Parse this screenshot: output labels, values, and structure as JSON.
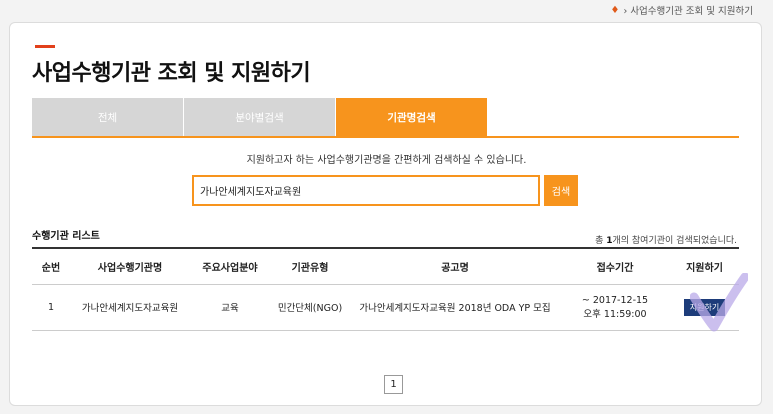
{
  "breadcrumb": {
    "text": "› 사업수행기관 조회 및 지원하기"
  },
  "page": {
    "title": "사업수행기관 조회 및 지원하기"
  },
  "tabs": [
    {
      "label": "전체"
    },
    {
      "label": "분야별검색"
    },
    {
      "label": "기관명검색"
    }
  ],
  "search": {
    "description": "지원하고자 하는 사업수행기관명을 간편하게 검색하실 수 있습니다.",
    "value": "가나안세계지도자교육원",
    "button_label": "검색"
  },
  "list": {
    "title": "수행기관 리스트",
    "count_prefix": "총 ",
    "count": "1",
    "count_suffix": "개의 참여기관이 검색되었습니다.",
    "headers": [
      "순번",
      "사업수행기관명",
      "주요사업분야",
      "기관유형",
      "공고명",
      "접수기간",
      "지원하기"
    ],
    "rows": [
      {
        "no": "1",
        "org": "가나안세계지도자교육원",
        "field": "교육",
        "type": "민간단체(NGO)",
        "notice": "가나안세계지도자교육원 2018년 ODA YP 모집",
        "period_line1": "~ 2017-12-15",
        "period_line2": "오후 11:59:00",
        "apply_label": "지원하기"
      }
    ]
  },
  "pagination": {
    "current": "1"
  },
  "colors": {
    "accent": "#f7941d",
    "title_bar": "#e2401b",
    "apply_button": "#1d3c7a",
    "tab_inactive": "#d6d6d6"
  }
}
